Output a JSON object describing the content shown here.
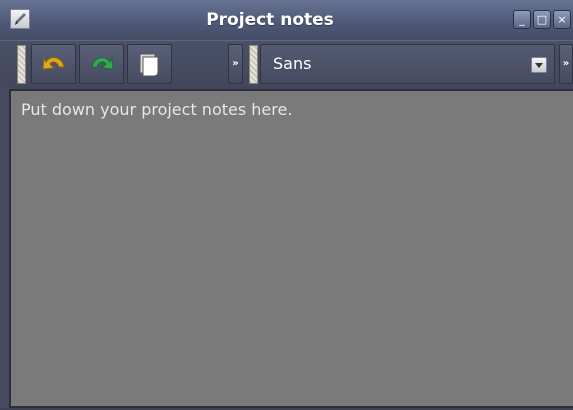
{
  "window": {
    "title": "Project notes",
    "controls": {
      "minimize": "_",
      "maximize": "□",
      "close": "×"
    }
  },
  "toolbar": {
    "buttons": [
      {
        "name": "undo",
        "icon": "undo-arrow-icon",
        "color": "#e0a81c"
      },
      {
        "name": "redo",
        "icon": "redo-arrow-icon",
        "color": "#34a853"
      },
      {
        "name": "new-page",
        "icon": "page-icon",
        "color": "#ffffff"
      }
    ],
    "overflow_label": "»",
    "font": {
      "value": "Sans"
    }
  },
  "editor": {
    "text": "Put down your project notes here."
  },
  "colors": {
    "titlebar": "#5b6684",
    "toolbar": "#464b60",
    "editor_bg": "#7a7a7a",
    "editor_text": "#e6e6e6"
  }
}
